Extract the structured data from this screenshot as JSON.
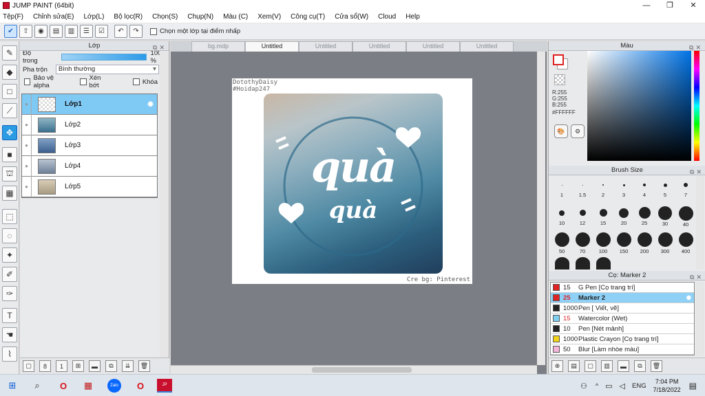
{
  "window": {
    "title": "JUMP PAINT (64bit)"
  },
  "menu": [
    "Tệp(F)",
    "Chỉnh sửa(E)",
    "Lớp(L)",
    "Bộ lọc(R)",
    "Chọn(S)",
    "Chụp(N)",
    "Màu (C)",
    "Xem(V)",
    "Công cụ(T)",
    "Cửa sổ(W)",
    "Cloud",
    "Help"
  ],
  "toolbar": {
    "snap_label": "Chọn một lớp tại điểm nhấp"
  },
  "layer_panel": {
    "title": "Lớp",
    "opacity_label": "Độ trong",
    "opacity_value": "100 %",
    "blend_label": "Pha trộn",
    "blend_value": "Bình thường",
    "protect_alpha": "Bảo vệ alpha",
    "clipping": "Xén bớt",
    "lock": "Khóa",
    "layers": [
      {
        "name": "Lớp1",
        "selected": true
      },
      {
        "name": "Lớp2",
        "selected": false
      },
      {
        "name": "Lớp3",
        "selected": false
      },
      {
        "name": "Lớp4",
        "selected": false
      },
      {
        "name": "Lớp5",
        "selected": false
      }
    ]
  },
  "tabs": [
    {
      "label": "bg.mdp",
      "active": false
    },
    {
      "label": "Untitled",
      "active": true
    },
    {
      "label": "Untitled",
      "active": false
    },
    {
      "label": "Untitled",
      "active": false
    },
    {
      "label": "Untitled",
      "active": false
    },
    {
      "label": "Untitled",
      "active": false
    }
  ],
  "canvas": {
    "watermark_top_1": "DotothyDaisy",
    "watermark_top_2": "#Hoidap247",
    "art_text_main": "quà",
    "art_text_sub": "quà",
    "watermark_bottom": "Cre bg: Pinterest"
  },
  "color_panel": {
    "title": "Màu",
    "r": "R:255",
    "g": "G:255",
    "b": "B:255",
    "hex": "#FFFFFF"
  },
  "brush_size_panel": {
    "title": "Brush Size",
    "sizes": [
      "1",
      "1.5",
      "2",
      "3",
      "4",
      "5",
      "7",
      "10",
      "12",
      "15",
      "20",
      "25",
      "30",
      "40",
      "50",
      "70",
      "100",
      "150",
      "200",
      "300",
      "400"
    ]
  },
  "brush_list_panel": {
    "title": "Cọ: Marker 2",
    "items": [
      {
        "size": "15",
        "name": "G Pen [Cọ trang trí]",
        "color": "#e02424",
        "selected": false
      },
      {
        "size": "25",
        "name": "Marker 2",
        "color": "#e02424",
        "selected": true
      },
      {
        "size": "1000",
        "name": "Pen [ Viết, vẽ]",
        "color": "#222222",
        "selected": false
      },
      {
        "size": "15",
        "name": "Watercolor (Wet)",
        "color": "#7fd0f0",
        "selected": false
      },
      {
        "size": "10",
        "name": "Pen [Nét mảnh]",
        "color": "#222222",
        "selected": false
      },
      {
        "size": "1000",
        "name": "Plastic Crayon [Cọ trang trí]",
        "color": "#f2d21b",
        "selected": false
      },
      {
        "size": "50",
        "name": "Blur [Làm nhòe màu]",
        "color": "#f4b6d8",
        "selected": false
      }
    ]
  },
  "taskbar": {
    "lang": "ENG",
    "time": "7:04 PM",
    "date": "7/18/2022"
  }
}
